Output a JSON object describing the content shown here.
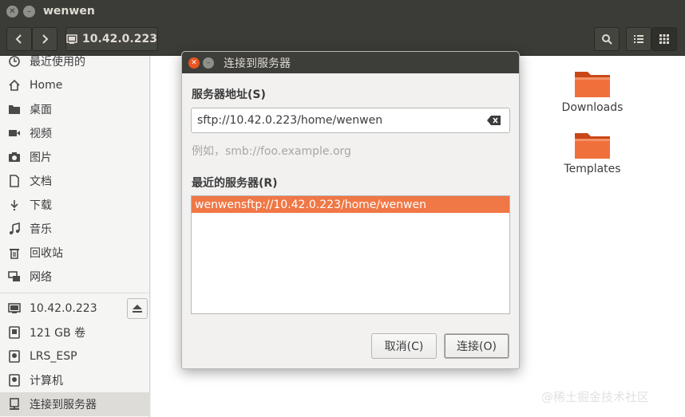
{
  "window": {
    "title": "wenwen"
  },
  "toolbar": {
    "path_label": "10.42.0.223"
  },
  "sidebar": {
    "places": [
      {
        "label": "最近使用的",
        "icon": "clock-icon"
      },
      {
        "label": "Home",
        "icon": "home-icon"
      },
      {
        "label": "桌面",
        "icon": "folder-icon"
      },
      {
        "label": "视频",
        "icon": "video-icon"
      },
      {
        "label": "图片",
        "icon": "camera-icon"
      },
      {
        "label": "文档",
        "icon": "document-icon"
      },
      {
        "label": "下载",
        "icon": "download-icon"
      },
      {
        "label": "音乐",
        "icon": "music-icon"
      },
      {
        "label": "回收站",
        "icon": "trash-icon"
      },
      {
        "label": "网络",
        "icon": "network-icon"
      }
    ],
    "devices": [
      {
        "label": "10.42.0.223",
        "icon": "network-drive-icon"
      },
      {
        "label": "121 GB 卷",
        "icon": "drive-icon"
      },
      {
        "label": "LRS_ESP",
        "icon": "drive-icon"
      },
      {
        "label": "计算机",
        "icon": "drive-icon"
      },
      {
        "label": "连接到服务器",
        "icon": "server-icon"
      }
    ]
  },
  "content": {
    "folders": [
      {
        "label": "Downloads",
        "icon": "folder-icon"
      },
      {
        "label": "Templates",
        "icon": "folder-icon"
      }
    ]
  },
  "watermark": "@稀土掘金技术社区",
  "dialog": {
    "title": "连接到服务器",
    "address_label": "服务器地址(S)",
    "address_value": "sftp://10.42.0.223/home/wenwen",
    "hint": "例如，smb://foo.example.org",
    "recent_label": "最近的服务器(R)",
    "recent_servers": [
      {
        "name": "wenwen",
        "uri": "sftp://10.42.0.223/home/wenwen"
      }
    ],
    "cancel_label": "取消(C)",
    "connect_label": "连接(O)"
  },
  "colors": {
    "accent": "#e95420",
    "selection": "#f07746",
    "titlebar": "#3b3b37"
  }
}
